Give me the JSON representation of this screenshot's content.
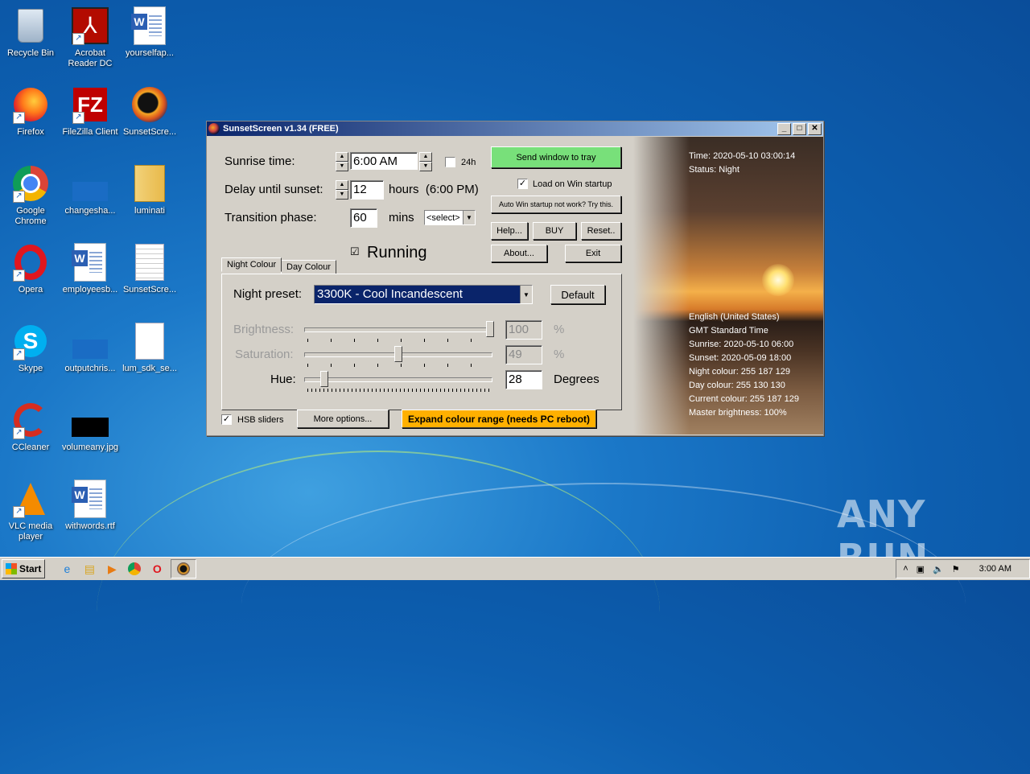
{
  "desktop": {
    "icons": [
      {
        "label": "Recycle Bin"
      },
      {
        "label": "Acrobat Reader DC"
      },
      {
        "label": "yourselfap..."
      },
      {
        "label": "Firefox"
      },
      {
        "label": "FileZilla Client"
      },
      {
        "label": "SunsetScre..."
      },
      {
        "label": "Google Chrome"
      },
      {
        "label": "changesha..."
      },
      {
        "label": "luminati"
      },
      {
        "label": "Opera"
      },
      {
        "label": "employeesb..."
      },
      {
        "label": "SunsetScre..."
      },
      {
        "label": "Skype"
      },
      {
        "label": "outputchris..."
      },
      {
        "label": "lum_sdk_se..."
      },
      {
        "label": "CCleaner"
      },
      {
        "label": "volumeany.jpg"
      },
      {
        "label": "VLC media player"
      },
      {
        "label": "withwords.rtf"
      }
    ],
    "watermark": "ANY RUN"
  },
  "window": {
    "title": "SunsetScreen v1.34 (FREE)",
    "sunrise_label": "Sunrise time:",
    "sunrise_value": "6:00 AM",
    "h24_label": "24h",
    "delay_label": "Delay until sunset:",
    "delay_value": "12",
    "delay_suffix": "hours  (6:00 PM)",
    "transition_label": "Transition phase:",
    "transition_value": "60",
    "transition_unit": "mins",
    "transition_select": "<select>",
    "running_label": "Running",
    "running_checked": true,
    "buttons": {
      "send_tray": "Send window to tray",
      "load_startup": "Load on Win startup",
      "auto_startup": "Auto Win startup not work? Try this.",
      "help": "Help...",
      "buy": "BUY",
      "reset": "Reset..",
      "about": "About...",
      "exit": "Exit",
      "default": "Default",
      "more_options": "More options...",
      "expand": "Expand colour range (needs PC reboot)"
    },
    "tabs": [
      "Night Colour",
      "Day Colour"
    ],
    "night_preset_label": "Night preset:",
    "night_preset_value": "3300K - Cool Incandescent",
    "brightness_label": "Brightness:",
    "brightness_value": "100",
    "saturation_label": "Saturation:",
    "saturation_value": "49",
    "hue_label": "Hue:",
    "hue_value": "28",
    "percent": "%",
    "degrees": "Degrees",
    "hsb_label": "HSB sliders",
    "info_top": [
      "Time: 2020-05-10 03:00:14",
      "Status: Night"
    ],
    "info_bottom": [
      "English (United States)",
      "GMT Standard Time",
      "Sunrise: 2020-05-10 06:00",
      "Sunset: 2020-05-09 18:00",
      "Night colour: 255 187 129",
      "Day colour: 255 130 130",
      "Current colour: 255 187 129",
      "Master brightness: 100%"
    ]
  },
  "taskbar": {
    "start": "Start",
    "clock": "3:00 AM"
  }
}
